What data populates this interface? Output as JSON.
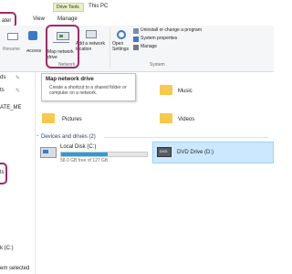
{
  "title_bar": {
    "drive_tools_tab": "Drive Tools",
    "window_title": "This PC"
  },
  "tabs": {
    "view": "View",
    "manage": "Manage",
    "left_cut": "ater"
  },
  "ribbon": {
    "rename_label": "Rename",
    "access_media_label": "Access media",
    "map_network_drive_label": "Map network drive",
    "add_network_location_label": "Add a network location",
    "network_group": "Network",
    "open_settings_label": "Open Settings",
    "uninstall_label": "Uninstall or change a program",
    "system_properties_label": "System properties",
    "manage_label": "Manage",
    "system_group": "System"
  },
  "tooltip": {
    "title": "Map network drive",
    "description": "Create a shortcut to a shared folder or computer on a network."
  },
  "nav_pane": {
    "item_1": "ds",
    "item_2": "ts",
    "item_3": "ATE_ME",
    "item_4": "ts",
    "item_5": "k (C:)",
    "status": "em selected"
  },
  "folders": {
    "music": "Music",
    "pictures": "Pictures",
    "videos": "Videos"
  },
  "devices": {
    "header": "Devices and drives (2)",
    "local_disk_name": "Local Disk (C:)",
    "local_disk_free": "58.0 GB free of 127 GB",
    "local_disk_used_fraction": 0.54,
    "dvd_name": "DVD Drive (D:)"
  },
  "colors": {
    "highlight_ring": "#a4286b",
    "usage_bar": "#26a0da",
    "folder": "#f8c94a",
    "selection": "#cce8ff"
  }
}
